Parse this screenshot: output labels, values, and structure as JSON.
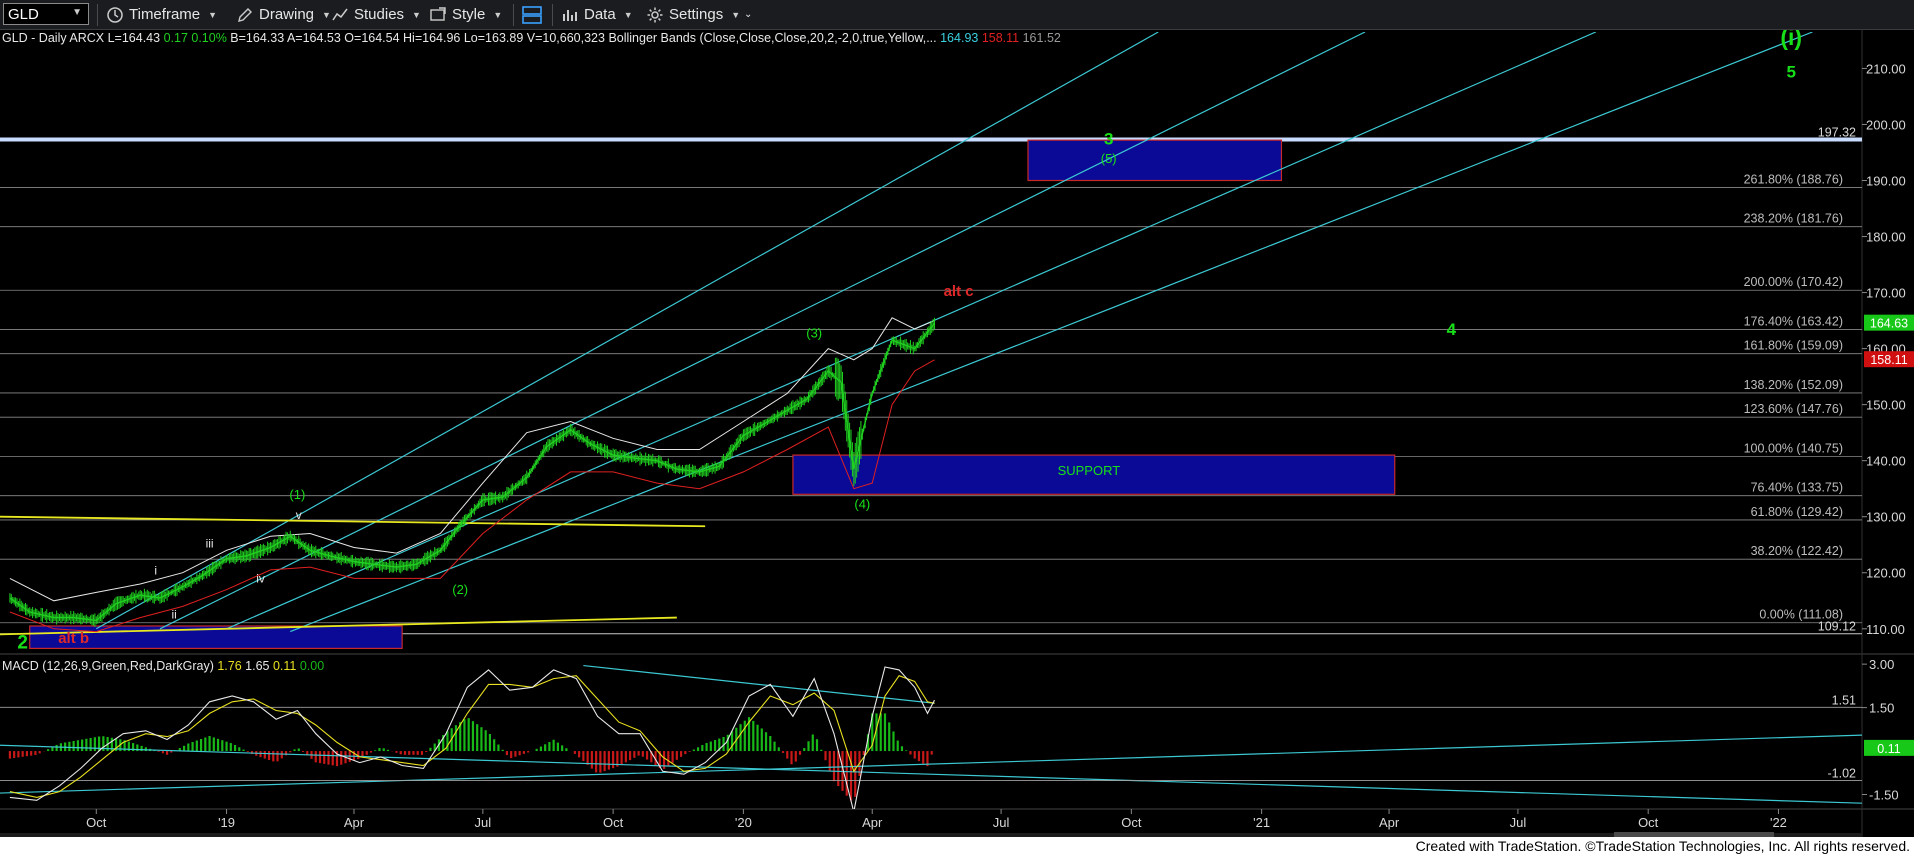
{
  "toolbar": {
    "symbol": "GLD",
    "items": [
      "Timeframe",
      "Drawing",
      "Studies",
      "Style",
      "Data",
      "Settings"
    ]
  },
  "chart_data": {
    "type": "line",
    "instrument": "GLD",
    "price_panel": {
      "header": {
        "title": "GLD - Daily",
        "exchange": "ARCX",
        "last": "L=164.43",
        "change": "0.17",
        "change_pct": "0.10%",
        "bid": "B=164.33",
        "ask": "A=164.53",
        "open": "O=164.54",
        "high": "Hi=164.96",
        "low": "Lo=163.89",
        "volume": "V=10,660,323",
        "indicator": "Bollinger Bands (Close,Close,Close,20,2,-2,0,true,Yellow,...",
        "bb_upper": "164.93",
        "bb_lower": "158.11",
        "bb_mid": "161.52"
      },
      "ylim": [
        105.5,
        216.5
      ],
      "y_ticks": [
        110,
        120,
        130,
        140,
        150,
        160,
        170,
        180,
        190,
        200,
        210
      ],
      "y_tick_labels": [
        "110.00",
        "120.00",
        "130.00",
        "140.00",
        "150.00",
        "160.00",
        "170.00",
        "180.00",
        "190.00",
        "200.00",
        "210.00"
      ],
      "fib_levels": [
        {
          "label": "0.00% (111.08)",
          "value": 111.08
        },
        {
          "label": "38.20% (122.42)",
          "value": 122.42
        },
        {
          "label": "61.80% (129.42)",
          "value": 129.42
        },
        {
          "label": "76.40% (133.75)",
          "value": 133.75
        },
        {
          "label": "100.00% (140.75)",
          "value": 140.75
        },
        {
          "label": "123.60% (147.76)",
          "value": 147.76
        },
        {
          "label": "138.20% (152.09)",
          "value": 152.09
        },
        {
          "label": "161.80% (159.09)",
          "value": 159.09
        },
        {
          "label": "176.40% (163.42)",
          "value": 163.42
        },
        {
          "label": "200.00% (170.42)",
          "value": 170.42
        },
        {
          "label": "238.20% (181.76)",
          "value": 181.76
        },
        {
          "label": "261.80% (188.76)",
          "value": 188.76
        }
      ],
      "horizontal_lines": [
        {
          "label": "197.32",
          "value": 197.32,
          "color": "#c8dcff"
        },
        {
          "label": "109.12",
          "value": 109.12,
          "color": "#c8c8c8"
        }
      ],
      "price_flags": [
        {
          "label": "164.63",
          "value": 164.63,
          "color": "#18c818"
        },
        {
          "label": "158.11",
          "value": 158.11,
          "color": "#d01010"
        }
      ],
      "price_series": {
        "name": "GLD",
        "x": [
          "2018-08-01",
          "2018-08-15",
          "2018-09-01",
          "2018-09-15",
          "2018-10-01",
          "2018-10-15",
          "2018-11-01",
          "2018-11-15",
          "2018-12-01",
          "2018-12-15",
          "2019-01-01",
          "2019-01-15",
          "2019-02-01",
          "2019-02-15",
          "2019-03-01",
          "2019-03-15",
          "2019-04-01",
          "2019-04-15",
          "2019-05-01",
          "2019-05-15",
          "2019-06-01",
          "2019-06-15",
          "2019-07-01",
          "2019-07-15",
          "2019-08-01",
          "2019-08-15",
          "2019-09-01",
          "2019-09-15",
          "2019-10-01",
          "2019-10-15",
          "2019-11-01",
          "2019-11-15",
          "2019-12-01",
          "2019-12-15",
          "2020-01-01",
          "2020-01-15",
          "2020-02-01",
          "2020-02-15",
          "2020-03-01",
          "2020-03-10",
          "2020-03-19",
          "2020-04-01",
          "2020-04-15",
          "2020-05-01",
          "2020-05-15"
        ],
        "y": [
          115.5,
          113.0,
          112.0,
          112.0,
          111.5,
          114.5,
          116.0,
          115.5,
          117.5,
          119.5,
          122.5,
          123.0,
          124.5,
          126.5,
          124.0,
          123.0,
          122.0,
          121.5,
          121.0,
          121.5,
          124.0,
          128.5,
          133.0,
          133.5,
          137.0,
          142.5,
          145.5,
          143.0,
          141.0,
          140.5,
          140.0,
          138.5,
          138.0,
          139.0,
          144.5,
          146.5,
          149.0,
          151.0,
          156.0,
          154.0,
          138.5,
          152.0,
          161.5,
          160.0,
          164.5
        ]
      },
      "bb_upper_series": {
        "x": [
          "2018-08-01",
          "2018-09-01",
          "2018-10-01",
          "2018-11-01",
          "2018-12-01",
          "2019-01-01",
          "2019-02-01",
          "2019-03-01",
          "2019-04-01",
          "2019-05-01",
          "2019-06-01",
          "2019-07-01",
          "2019-08-01",
          "2019-09-01",
          "2019-10-01",
          "2019-11-01",
          "2019-12-01",
          "2020-01-01",
          "2020-02-01",
          "2020-03-01",
          "2020-03-19",
          "2020-04-01",
          "2020-04-15",
          "2020-05-01",
          "2020-05-15"
        ],
        "y": [
          119,
          115,
          116.5,
          118,
          120,
          124,
          126.5,
          127,
          124.5,
          123.5,
          127,
          136,
          145,
          147,
          144,
          142,
          142,
          147,
          152,
          160,
          158,
          160,
          165.5,
          163.5,
          165
        ]
      },
      "bb_lower_series": {
        "x": [
          "2018-08-01",
          "2018-09-01",
          "2018-10-01",
          "2018-11-01",
          "2018-12-01",
          "2019-01-01",
          "2019-02-01",
          "2019-03-01",
          "2019-04-01",
          "2019-05-01",
          "2019-06-01",
          "2019-07-01",
          "2019-08-01",
          "2019-09-01",
          "2019-10-01",
          "2019-11-01",
          "2019-12-01",
          "2020-01-01",
          "2020-02-01",
          "2020-03-01",
          "2020-03-19",
          "2020-04-01",
          "2020-04-15",
          "2020-05-01",
          "2020-05-15"
        ],
        "y": [
          113,
          110,
          109.5,
          112,
          114,
          117,
          120.5,
          121,
          119,
          119,
          119,
          127,
          133,
          138,
          138,
          136,
          135,
          138,
          142,
          146,
          135,
          136,
          150,
          156,
          158
        ]
      },
      "trend_channel_lines": [
        {
          "x": [
            "2018-10-01",
            "2020-10-20"
          ],
          "y": [
            110.0,
            216.5
          ]
        },
        {
          "x": [
            "2018-11-15",
            "2021-03-15"
          ],
          "y": [
            110.0,
            216.5
          ]
        },
        {
          "x": [
            "2019-01-01",
            "2021-08-25"
          ],
          "y": [
            110.0,
            216.5
          ]
        },
        {
          "x": [
            "2019-02-15",
            "2022-01-25"
          ],
          "y": [
            109.5,
            216.5
          ]
        }
      ],
      "triangle_lines": [
        {
          "x": [
            "2018-07-25",
            "2019-12-05"
          ],
          "y": [
            130.0,
            128.3
          ],
          "color": "#e8e820"
        },
        {
          "x": [
            "2018-07-25",
            "2019-11-15"
          ],
          "y": [
            109.0,
            112.0
          ],
          "color": "#e8e820"
        }
      ],
      "zones": [
        {
          "label": "SUPPORT",
          "x": [
            "2020-02-05",
            "2021-04-05"
          ],
          "y": [
            134.0,
            141.0
          ]
        },
        {
          "label": "",
          "x": [
            "2020-07-20",
            "2021-01-15"
          ],
          "y": [
            190.0,
            197.2
          ]
        },
        {
          "label": "",
          "x": [
            "2018-08-15",
            "2019-05-05"
          ],
          "y": [
            106.5,
            110.5
          ]
        }
      ],
      "annotations": [
        {
          "text": "(i)",
          "x": "2022-01-10",
          "y": 214.2,
          "color": "#18e018",
          "size": 23,
          "bold": true
        },
        {
          "text": "5",
          "x": "2022-01-10",
          "y": 208.4,
          "color": "#18e018",
          "size": 17,
          "bold": true
        },
        {
          "text": "3",
          "x": "2020-09-15",
          "y": 196.4,
          "color": "#18e018",
          "size": 17,
          "bold": true
        },
        {
          "text": "(5)",
          "x": "2020-09-15",
          "y": 193.1,
          "color": "#18e018",
          "size": 13,
          "bold": false
        },
        {
          "text": "alt c",
          "x": "2020-06-01",
          "y": 169.4,
          "color": "#e02828",
          "size": 15,
          "bold": true
        },
        {
          "text": "4",
          "x": "2021-05-15",
          "y": 162.4,
          "color": "#18e018",
          "size": 17,
          "bold": true
        },
        {
          "text": "(3)",
          "x": "2020-02-20",
          "y": 162.0,
          "color": "#18e018",
          "size": 13,
          "bold": false
        },
        {
          "text": "(4)",
          "x": "2020-03-25",
          "y": 131.5,
          "color": "#18e018",
          "size": 13,
          "bold": false
        },
        {
          "text": "SUPPORT",
          "x": "2020-09-01",
          "y": 137.4,
          "color": "#18e018",
          "size": 13,
          "bold": false
        },
        {
          "text": "(1)",
          "x": "2019-02-20",
          "y": 133.2,
          "color": "#18e018",
          "size": 13,
          "bold": false
        },
        {
          "text": "v",
          "x": "2019-02-21",
          "y": 129.6,
          "color": "#e8e8e8",
          "size": 12,
          "bold": false
        },
        {
          "text": "iii",
          "x": "2018-12-20",
          "y": 124.5,
          "color": "#e8e8e8",
          "size": 12,
          "bold": false
        },
        {
          "text": "iv",
          "x": "2019-01-25",
          "y": 118.3,
          "color": "#e8e8e8",
          "size": 12,
          "bold": false
        },
        {
          "text": "i",
          "x": "2018-11-12",
          "y": 119.7,
          "color": "#e8e8e8",
          "size": 12,
          "bold": false
        },
        {
          "text": "ii",
          "x": "2018-11-25",
          "y": 111.8,
          "color": "#e8e8e8",
          "size": 12,
          "bold": false
        },
        {
          "text": "(2)",
          "x": "2019-06-15",
          "y": 116.2,
          "color": "#18e018",
          "size": 13,
          "bold": false
        },
        {
          "text": "2",
          "x": "2018-08-10",
          "y": 106.5,
          "color": "#18e018",
          "size": 19,
          "bold": true
        },
        {
          "text": "alt b",
          "x": "2018-09-15",
          "y": 107.5,
          "color": "#e02828",
          "size": 15,
          "bold": true
        }
      ]
    },
    "macd_panel": {
      "header": {
        "title": "MACD (12,26,9,Green,Red,DarkGray)",
        "macd": "1.76",
        "signal": "1.65",
        "diff": "0.11",
        "zero": "0.00"
      },
      "ylim": [
        -2.0,
        3.35
      ],
      "y_ticks": [
        3.0,
        1.5,
        -1.5
      ],
      "y_tick_labels": [
        "3.00",
        "1.50",
        "-1.50"
      ],
      "level_labels": [
        {
          "label": "1.51",
          "value": 1.51
        },
        {
          "label": "-1.02",
          "value": -1.02
        }
      ],
      "value_flag": {
        "label": "0.11",
        "value": 0.11,
        "color": "#18c818"
      },
      "macd_series": {
        "x": [
          "2018-08-01",
          "2018-08-20",
          "2018-09-05",
          "2018-09-20",
          "2018-10-05",
          "2018-10-20",
          "2018-11-05",
          "2018-11-20",
          "2018-12-05",
          "2018-12-20",
          "2019-01-05",
          "2019-01-20",
          "2019-02-05",
          "2019-02-20",
          "2019-03-05",
          "2019-03-20",
          "2019-04-05",
          "2019-04-20",
          "2019-05-05",
          "2019-05-20",
          "2019-06-05",
          "2019-06-20",
          "2019-07-05",
          "2019-07-20",
          "2019-08-05",
          "2019-08-20",
          "2019-09-05",
          "2019-09-20",
          "2019-10-05",
          "2019-10-20",
          "2019-11-05",
          "2019-11-20",
          "2019-12-05",
          "2019-12-20",
          "2020-01-05",
          "2020-01-20",
          "2020-02-05",
          "2020-02-20",
          "2020-03-05",
          "2020-03-19",
          "2020-04-01",
          "2020-04-10",
          "2020-04-20",
          "2020-05-01",
          "2020-05-10",
          "2020-05-15"
        ],
        "y": [
          -1.6,
          -1.7,
          -1.2,
          -0.6,
          0.1,
          0.6,
          0.7,
          0.4,
          0.9,
          1.7,
          1.9,
          1.7,
          1.1,
          1.4,
          0.6,
          -0.1,
          -0.4,
          -0.2,
          -0.5,
          -0.6,
          0.6,
          2.2,
          2.8,
          2.1,
          2.2,
          2.8,
          2.5,
          1.2,
          0.6,
          0.6,
          -0.7,
          -0.8,
          -0.4,
          0.3,
          1.9,
          2.3,
          1.2,
          2.5,
          0.6,
          -2.1,
          1.2,
          2.9,
          2.8,
          2.2,
          1.3,
          1.76
        ]
      },
      "signal_series": {
        "x": [
          "2018-08-01",
          "2018-08-20",
          "2018-09-05",
          "2018-09-20",
          "2018-10-05",
          "2018-10-20",
          "2018-11-05",
          "2018-11-20",
          "2018-12-05",
          "2018-12-20",
          "2019-01-05",
          "2019-01-20",
          "2019-02-05",
          "2019-02-20",
          "2019-03-05",
          "2019-03-20",
          "2019-04-05",
          "2019-04-20",
          "2019-05-05",
          "2019-05-20",
          "2019-06-05",
          "2019-06-20",
          "2019-07-05",
          "2019-07-20",
          "2019-08-05",
          "2019-08-20",
          "2019-09-05",
          "2019-09-20",
          "2019-10-05",
          "2019-10-20",
          "2019-11-05",
          "2019-11-20",
          "2019-12-05",
          "2019-12-20",
          "2020-01-05",
          "2020-01-20",
          "2020-02-05",
          "2020-02-20",
          "2020-03-05",
          "2020-03-19",
          "2020-04-01",
          "2020-04-10",
          "2020-04-20",
          "2020-05-01",
          "2020-05-10",
          "2020-05-15"
        ],
        "y": [
          -1.4,
          -1.6,
          -1.4,
          -0.9,
          -0.3,
          0.3,
          0.6,
          0.5,
          0.7,
          1.3,
          1.7,
          1.8,
          1.4,
          1.3,
          0.9,
          0.3,
          -0.2,
          -0.3,
          -0.4,
          -0.5,
          0.1,
          1.3,
          2.3,
          2.3,
          2.2,
          2.5,
          2.6,
          1.8,
          1.0,
          0.7,
          -0.2,
          -0.7,
          -0.6,
          -0.1,
          1.0,
          1.9,
          1.6,
          2.0,
          1.4,
          -0.7,
          0.2,
          1.9,
          2.6,
          2.4,
          1.7,
          1.65
        ]
      },
      "trend_lines": [
        {
          "x": [
            "2018-07-25",
            "2022-03-01"
          ],
          "y": [
            0.2,
            -1.8
          ]
        },
        {
          "x": [
            "2018-07-25",
            "2022-03-01"
          ],
          "y": [
            -1.45,
            0.55
          ]
        },
        {
          "x": [
            "2019-09-10",
            "2020-05-15"
          ],
          "y": [
            2.95,
            1.65
          ]
        }
      ]
    },
    "x_axis": {
      "range": [
        "2018-07-25",
        "2022-03-01"
      ],
      "ticks": [
        {
          "label": "Oct",
          "x": "2018-10-01"
        },
        {
          "label": "'19",
          "x": "2019-01-01"
        },
        {
          "label": "Apr",
          "x": "2019-04-01"
        },
        {
          "label": "Jul",
          "x": "2019-07-01"
        },
        {
          "label": "Oct",
          "x": "2019-10-01"
        },
        {
          "label": "'20",
          "x": "2020-01-01"
        },
        {
          "label": "Apr",
          "x": "2020-04-01"
        },
        {
          "label": "Jul",
          "x": "2020-07-01"
        },
        {
          "label": "Oct",
          "x": "2020-10-01"
        },
        {
          "label": "'21",
          "x": "2021-01-01"
        },
        {
          "label": "Apr",
          "x": "2021-04-01"
        },
        {
          "label": "Jul",
          "x": "2021-07-01"
        },
        {
          "label": "Oct",
          "x": "2021-10-01"
        },
        {
          "label": "'22",
          "x": "2022-01-01"
        }
      ]
    }
  },
  "footer": {
    "text": "Created with TradeStation. ©TradeStation Technologies, Inc. All rights reserved."
  }
}
